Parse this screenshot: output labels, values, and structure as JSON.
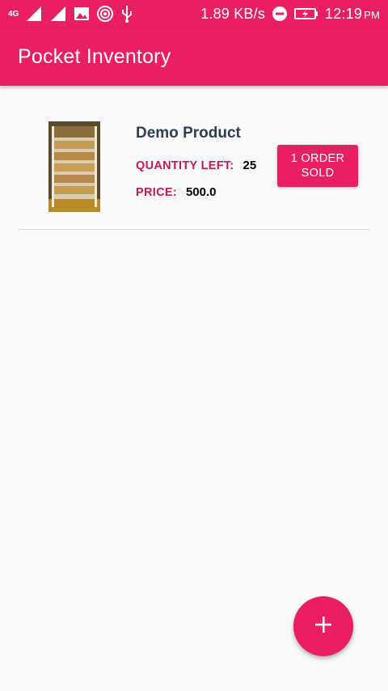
{
  "status_bar": {
    "network_type": "4G",
    "data_speed": "1.89 KB/s",
    "time": "12:19",
    "ampm": "PM",
    "icons": [
      "signal-icon",
      "signal-icon",
      "image-icon",
      "hotspot-icon",
      "usb-icon",
      "do-not-disturb-icon",
      "battery-charging-icon"
    ]
  },
  "app_bar": {
    "title": "Pocket Inventory"
  },
  "products": [
    {
      "name": "Demo Product",
      "quantity_label": "QUANTITY LEFT:",
      "quantity_value": "25",
      "price_label": "PRICE:",
      "price_value": "500.0",
      "order_button_label": "1 ORDER SOLD"
    }
  ],
  "fab": {
    "icon": "plus-icon"
  },
  "colors": {
    "primary": "#e91e63",
    "accent_text": "#c2185b",
    "product_name": "#2c3e50",
    "background": "#fafafa"
  }
}
